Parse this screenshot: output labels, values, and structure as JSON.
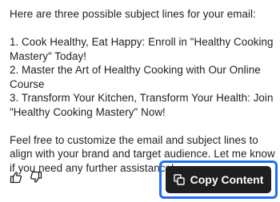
{
  "message": {
    "intro": "Here are three possible subject lines for your email:",
    "subject_lines": [
      "1. Cook Healthy, Eat Happy: Enroll in \"Healthy Cooking Mastery\" Today!",
      "2. Master the Art of Healthy Cooking with Our Online Course",
      "3. Transform Your Kitchen, Transform Your Health: Join \"Healthy Cooking Mastery\" Now!"
    ],
    "closing": "Feel free to customize the email and subject lines to align with your brand and target audience. Let me know if you need any further assistance!"
  },
  "actions": {
    "thumbs_up_icon": "thumbs-up-icon",
    "thumbs_down_icon": "thumbs-down-icon",
    "copy_icon": "copy-icon",
    "copy_label": "Copy Content"
  },
  "colors": {
    "text": "#1f1f1f",
    "button_bg": "#1f1f1f",
    "highlight": "#1e6ff2"
  }
}
